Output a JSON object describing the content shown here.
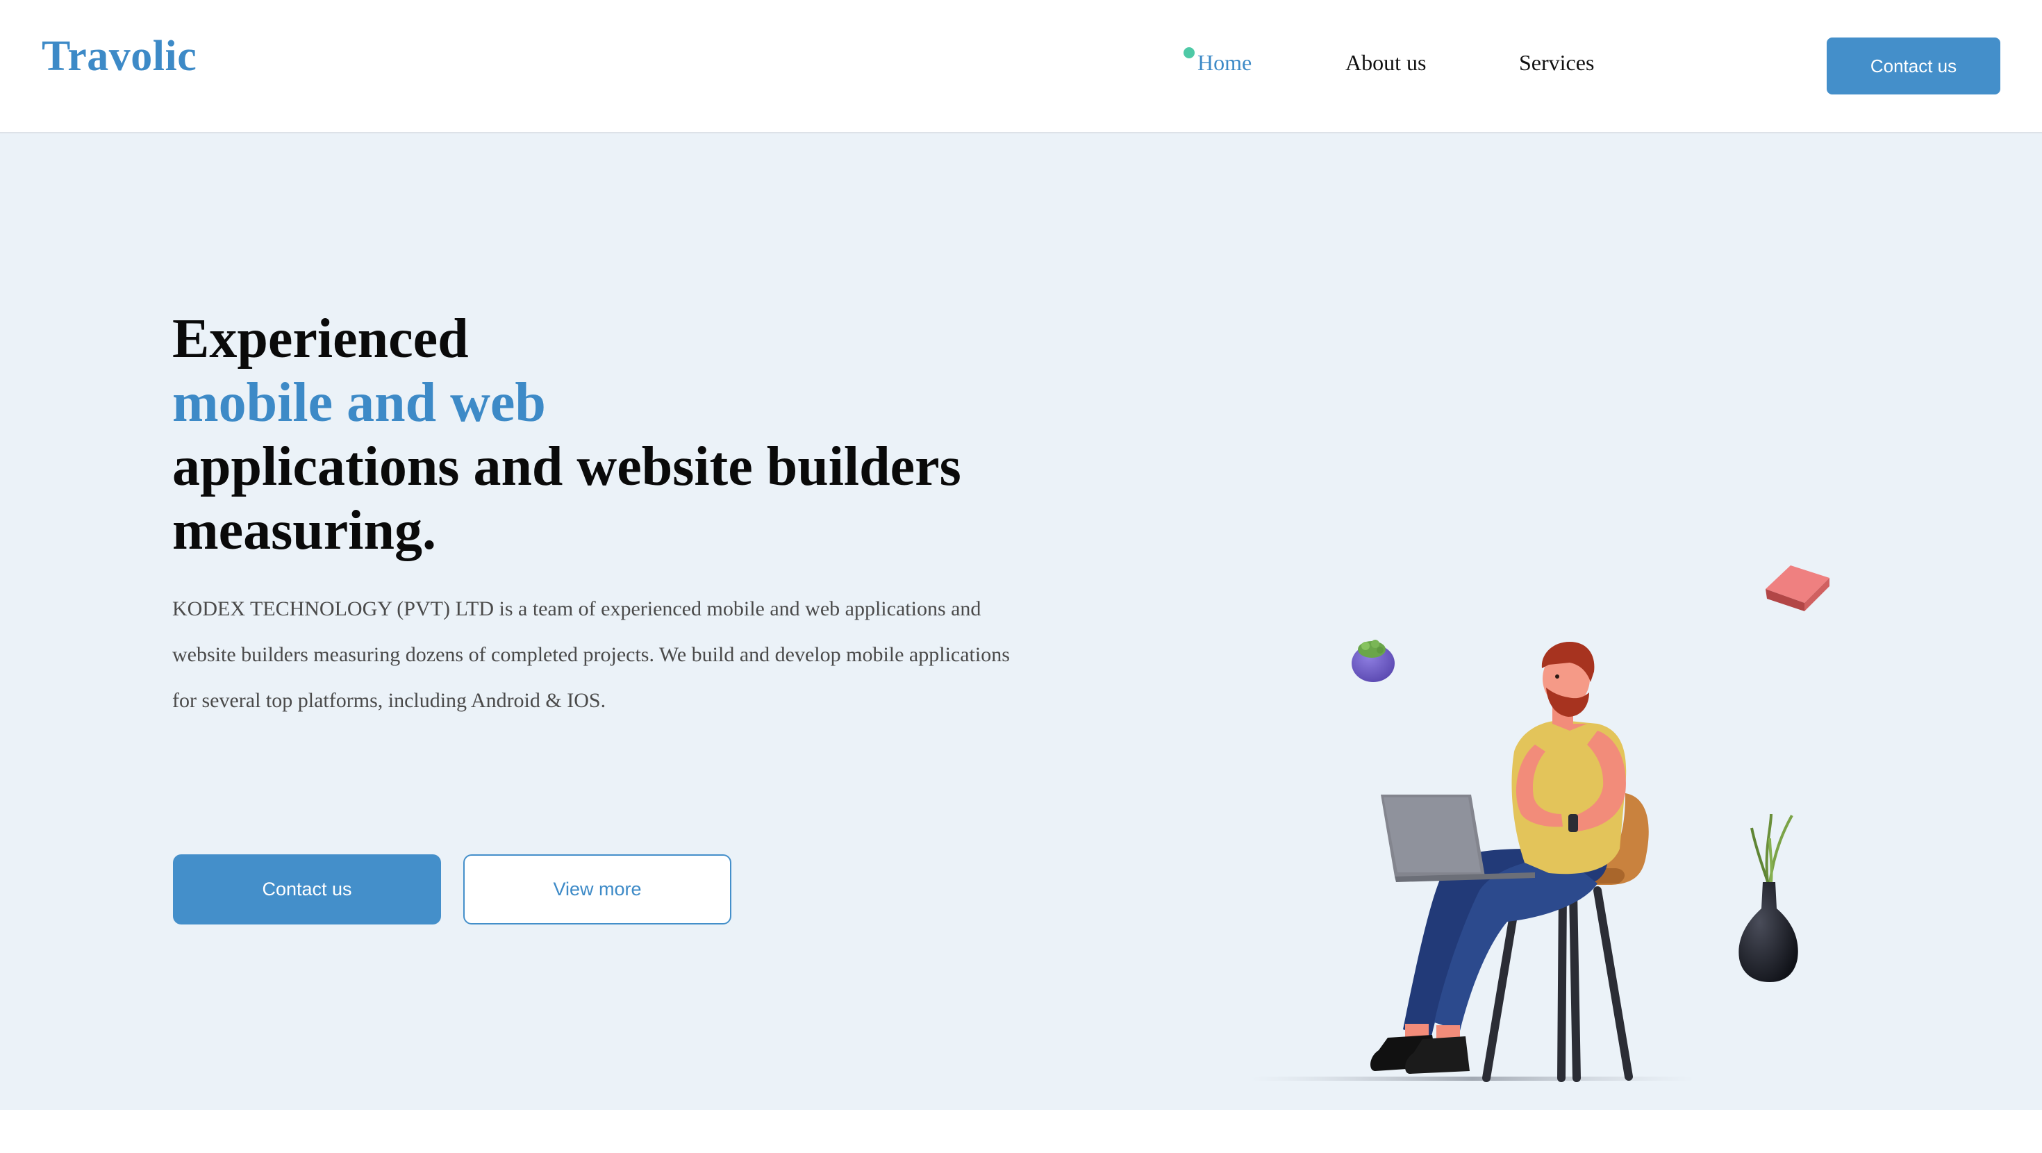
{
  "header": {
    "logo": "Travolic",
    "nav": [
      {
        "label": "Home",
        "active": true
      },
      {
        "label": "About us",
        "active": false
      },
      {
        "label": "Services",
        "active": false
      }
    ],
    "cta_label": "Contact us"
  },
  "hero": {
    "headline_line1": "Experienced",
    "headline_line2": "mobile and web",
    "headline_line3": "applications and website builders",
    "headline_line4": "measuring.",
    "description": "KODEX TECHNOLOGY (PVT) LTD is a team of experienced mobile and web applications and website builders measuring dozens of completed projects. We build and develop mobile applications for several top platforms, including Android & IOS.",
    "primary_button": "Contact us",
    "secondary_button": "View more"
  },
  "colors": {
    "accent": "#3d8ac7",
    "button": "#448fca",
    "hero_background": "#ebf2f8",
    "active_dot": "#4ec9a6"
  }
}
